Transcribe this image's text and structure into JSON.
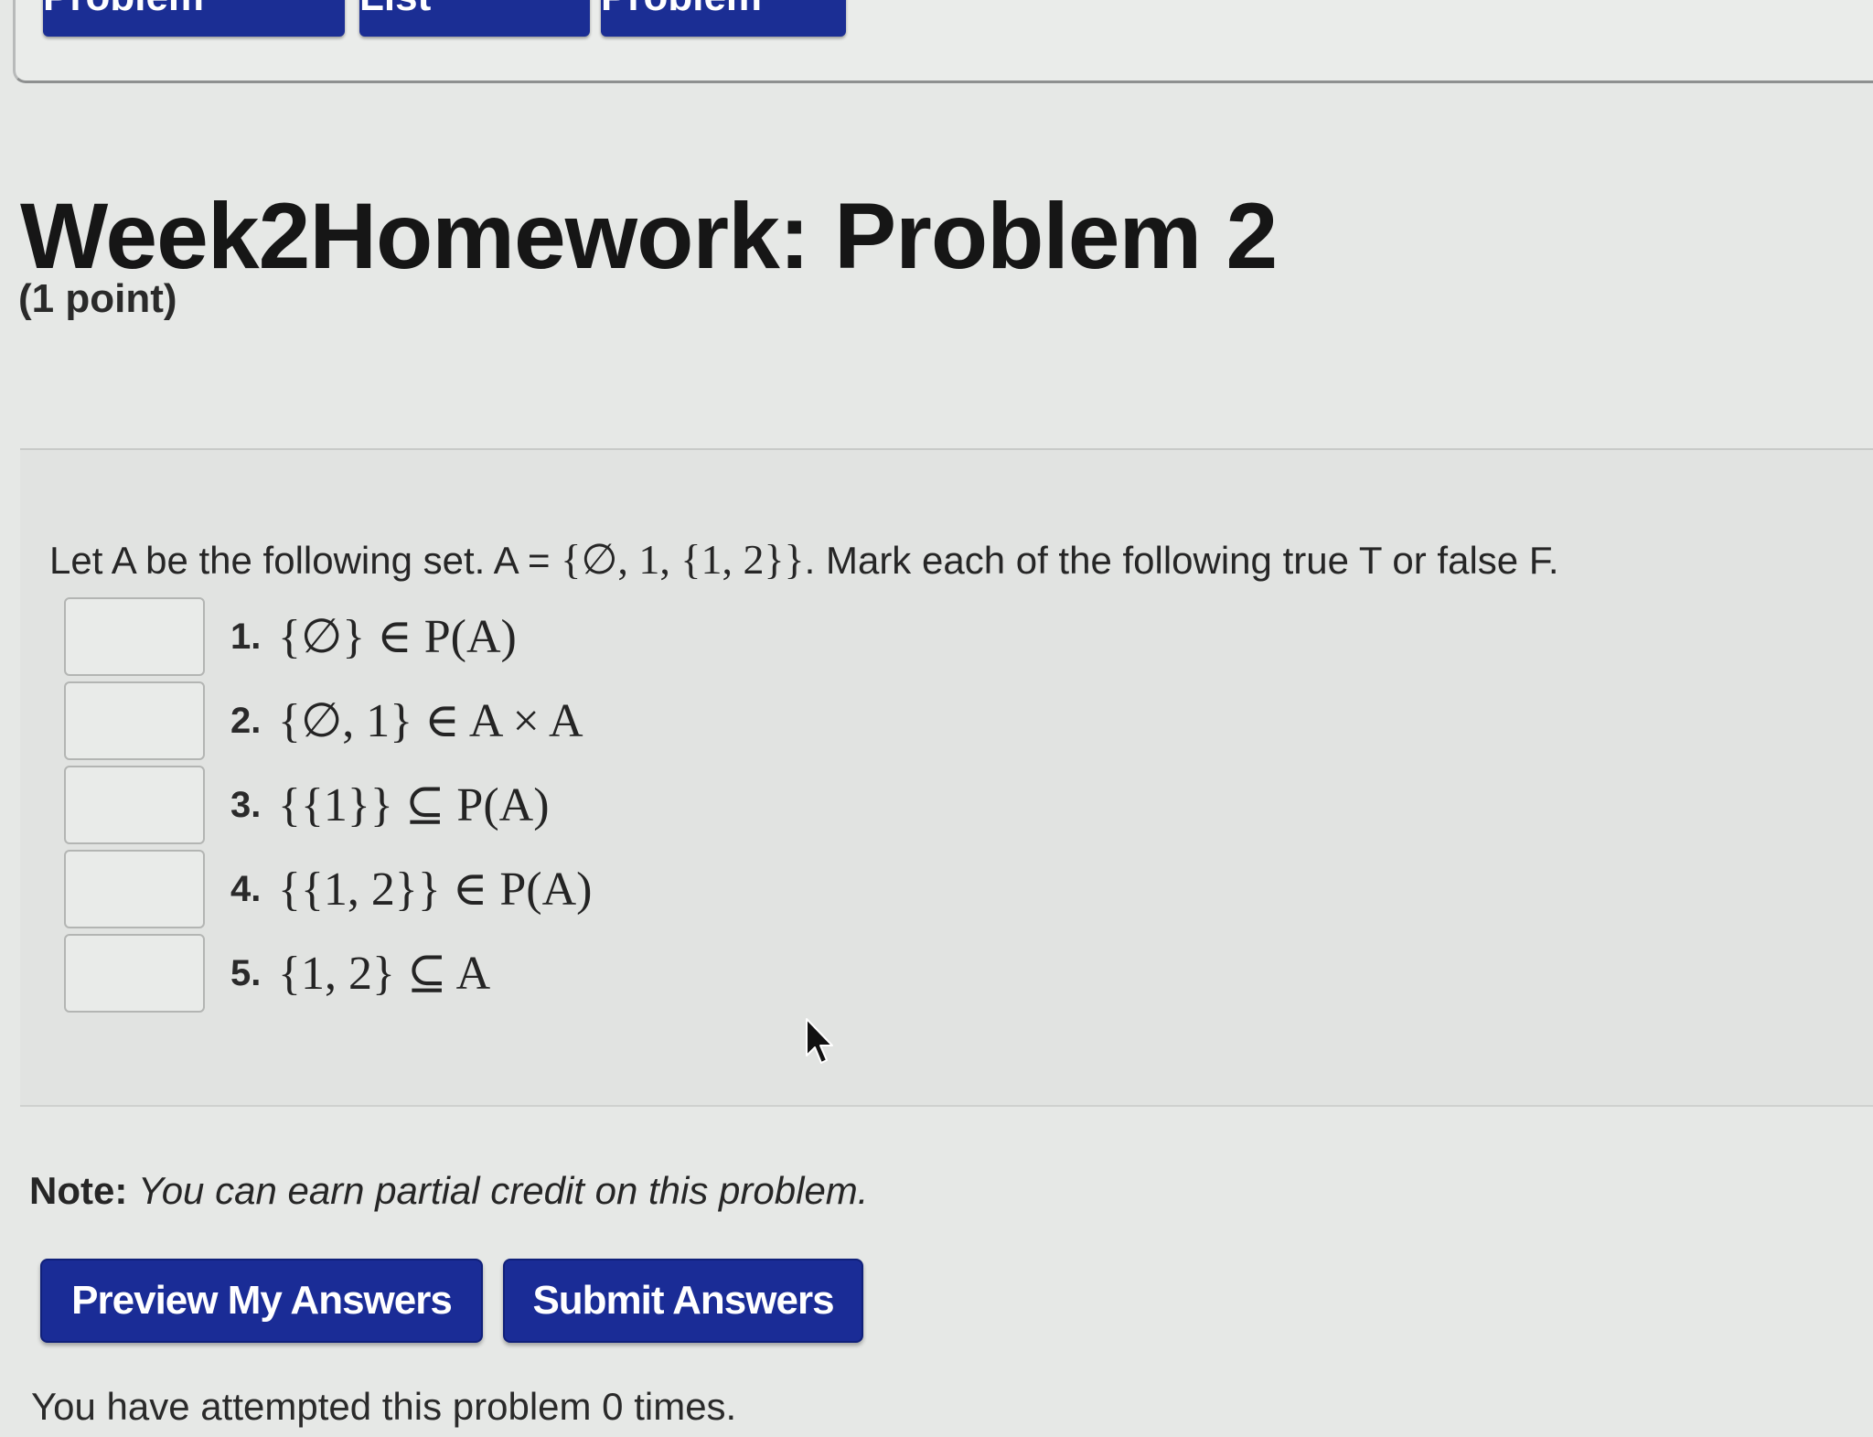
{
  "nav": {
    "previous_label": "Previous Problem",
    "list_label": "Problem List",
    "next_label": "Next Problem"
  },
  "header": {
    "title": "Week2Homework: Problem 2",
    "points": "(1 point)"
  },
  "problem": {
    "statement_prefix": "Let A be the following set. A = ",
    "set_expression": "{∅, 1, {1, 2}}",
    "statement_suffix": ". Mark each of the following true T or false F.",
    "items": [
      {
        "number": "1.",
        "expression": "{∅} ∈ P(A)",
        "answer": ""
      },
      {
        "number": "2.",
        "expression": "{∅, 1} ∈ A × A",
        "answer": ""
      },
      {
        "number": "3.",
        "expression": "{{1}} ⊆ P(A)",
        "answer": ""
      },
      {
        "number": "4.",
        "expression": "{{1, 2}} ∈ P(A)",
        "answer": ""
      },
      {
        "number": "5.",
        "expression": "{1, 2} ⊆ A",
        "answer": ""
      }
    ]
  },
  "note": {
    "label": "Note:",
    "text": "You can earn partial credit on this problem."
  },
  "actions": {
    "preview_label": "Preview My Answers",
    "submit_label": "Submit Answers"
  },
  "status": {
    "attempts_text": "You have attempted this problem 0 times."
  }
}
